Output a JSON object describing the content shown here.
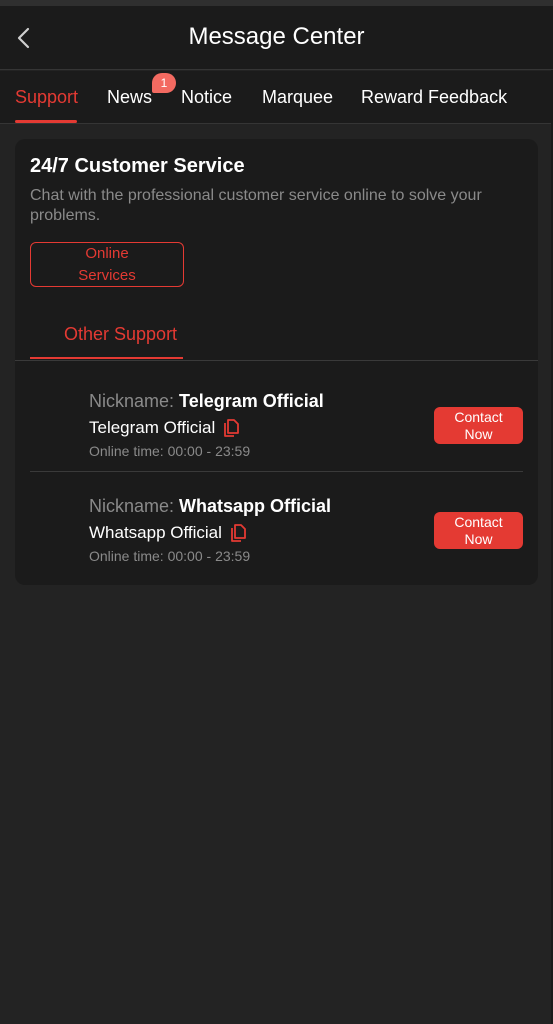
{
  "header": {
    "title": "Message Center"
  },
  "tabs": [
    {
      "label": "Support",
      "active": true
    },
    {
      "label": "News",
      "badge": "1"
    },
    {
      "label": "Notice"
    },
    {
      "label": "Marquee"
    },
    {
      "label": "Reward Feedback"
    }
  ],
  "card": {
    "title": "24/7 Customer Service",
    "description": "Chat with the professional customer service online to solve your problems.",
    "online_button": "Online Services",
    "other_support_tab": "Other Support"
  },
  "contacts": [
    {
      "nickname_label": "Nickname:",
      "nickname": "Telegram Official",
      "account": "Telegram Official",
      "online_time_label": "Online time:",
      "online_time": "00:00 - 23:59",
      "button": "Contact Now"
    },
    {
      "nickname_label": "Nickname:",
      "nickname": "Whatsapp Official",
      "account": "Whatsapp Official",
      "online_time_label": "Online time:",
      "online_time": "00:00 - 23:59",
      "button": "Contact Now"
    }
  ],
  "icons": {
    "back": "chevron-left-icon",
    "copy": "copy-icon"
  },
  "colors": {
    "accent": "#e43a33",
    "badge": "#f36a61",
    "background": "#232323",
    "panel": "#1b1b1b",
    "muted": "#8a8a8a"
  }
}
